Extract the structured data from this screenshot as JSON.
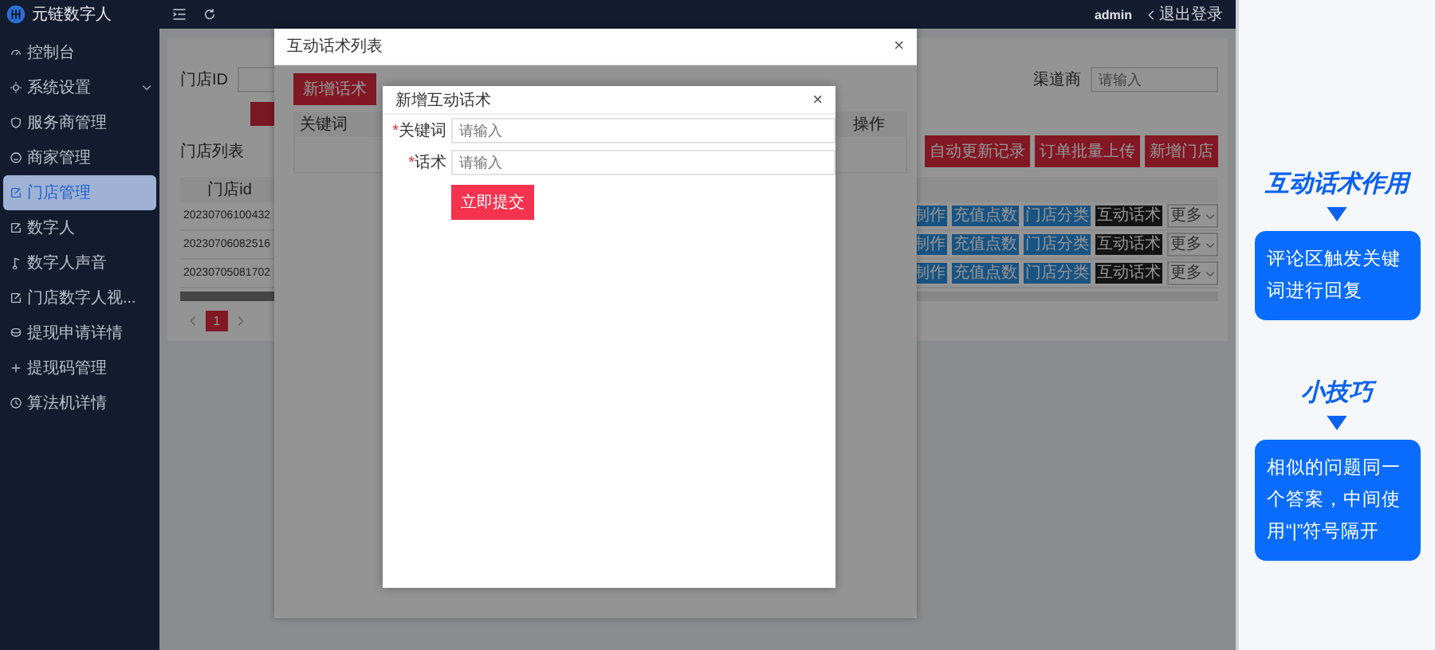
{
  "sidebar": {
    "brand": "元链数字人",
    "items": [
      {
        "label": "控制台",
        "selected": false,
        "expandable": false
      },
      {
        "label": "系统设置",
        "selected": false,
        "expandable": true
      },
      {
        "label": "服务商管理",
        "selected": false,
        "expandable": false
      },
      {
        "label": "商家管理",
        "selected": false,
        "expandable": false
      },
      {
        "label": "门店管理",
        "selected": true,
        "expandable": false
      },
      {
        "label": "数字人",
        "selected": false,
        "expandable": false
      },
      {
        "label": "数字人声音",
        "selected": false,
        "expandable": false
      },
      {
        "label": "门店数字人视...",
        "selected": false,
        "expandable": false
      },
      {
        "label": "提现申请详情",
        "selected": false,
        "expandable": false
      },
      {
        "label": "提现码管理",
        "selected": false,
        "expandable": false
      },
      {
        "label": "算法机详情",
        "selected": false,
        "expandable": false
      }
    ]
  },
  "topbar": {
    "user": "admin",
    "logout": "退出登录"
  },
  "store_page": {
    "filters": [
      {
        "label": "门店ID"
      },
      {
        "label": "渠道商",
        "placeholder": "请输入"
      }
    ],
    "list_title": "门店列表",
    "buttons": [
      "自动更新记录",
      "订单批量上传",
      "新增门店"
    ],
    "table": {
      "columns": [
        "门店id"
      ],
      "rows": [
        {
          "id": "20230706100432",
          "actions": [
            {
              "label": "制作",
              "kind": "primary"
            },
            {
              "label": "充值点数",
              "kind": "primary"
            },
            {
              "label": "门店分类",
              "kind": "primary"
            },
            {
              "label": "互动话术",
              "kind": "dark"
            },
            {
              "label": "更多",
              "kind": "dropdown"
            }
          ]
        },
        {
          "id": "20230706082516",
          "actions": [
            {
              "label": "制作",
              "kind": "primary"
            },
            {
              "label": "充值点数",
              "kind": "primary"
            },
            {
              "label": "门店分类",
              "kind": "primary"
            },
            {
              "label": "互动话术",
              "kind": "dark"
            },
            {
              "label": "更多",
              "kind": "dropdown"
            }
          ]
        },
        {
          "id": "20230705081702",
          "actions": [
            {
              "label": "制作",
              "kind": "primary"
            },
            {
              "label": "充值点数",
              "kind": "primary"
            },
            {
              "label": "门店分类",
              "kind": "primary"
            },
            {
              "label": "互动话术",
              "kind": "dark"
            },
            {
              "label": "更多",
              "kind": "dropdown"
            }
          ]
        }
      ]
    },
    "pagination": {
      "pages": [
        {
          "label": "1",
          "selected": true
        }
      ]
    }
  },
  "script_list_dialog": {
    "title": "互动话术列表",
    "close": "×",
    "add_button": "新增话术",
    "columns": [
      "关键词",
      "操作"
    ]
  },
  "add_script_dialog": {
    "title": "新增互动话术",
    "close": "×",
    "fields": [
      {
        "mark": "*",
        "label": "关键词",
        "placeholder": "请输入"
      },
      {
        "mark": "*",
        "label": "话术",
        "placeholder": "请输入"
      }
    ],
    "submit": "立即提交"
  },
  "tips": [
    {
      "heading": "互动话术作用",
      "body": "评论区触发关键词进行回复"
    },
    {
      "heading": "小技巧",
      "body": "相似的问题同一个答案，中间使用“|”符号隔开"
    }
  ]
}
